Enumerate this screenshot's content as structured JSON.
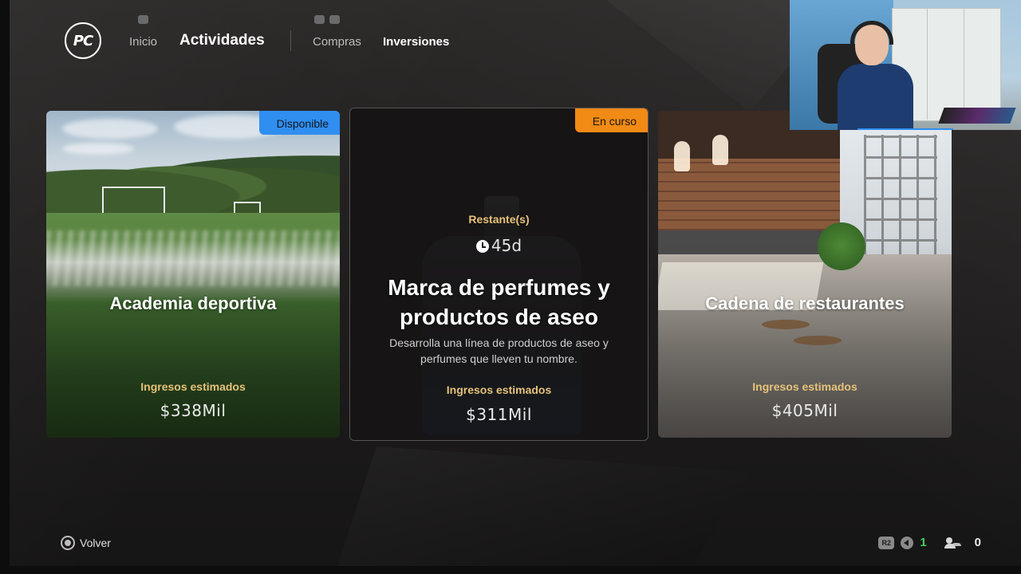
{
  "header": {
    "logo_text": "PC",
    "nav": {
      "inicio": "Inicio",
      "actividades": "Actividades",
      "compras": "Compras",
      "inversiones": "Inversiones"
    },
    "hints": {
      "left": "L1",
      "right_a": "L2",
      "right_b": "R2"
    }
  },
  "cards": [
    {
      "title": "Academia deportiva",
      "badge": "Disponible",
      "income_label": "Ingresos estimados",
      "income_value": "$338Mil"
    },
    {
      "title": "Marca de perfumes y productos de aseo",
      "badge": "En curso",
      "remaining_label": "Restante(s)",
      "remaining_value": "45d",
      "description": "Desarrolla una línea de productos de aseo y perfumes que lleven tu nombre.",
      "income_label": "Ingresos estimados",
      "income_value": "$311Mil"
    },
    {
      "title": "Cadena de restaurantes",
      "income_label": "Ingresos estimados",
      "income_value": "$405Mil"
    }
  ],
  "footer": {
    "back_label": "Volver",
    "r2_label": "R2",
    "green_count": "1",
    "friends_count": "0"
  },
  "colors": {
    "badge_available": "#2f8ef0",
    "badge_in_progress": "#f28a16",
    "gold_label": "#e6c27a",
    "online_green": "#3fcf5a"
  }
}
